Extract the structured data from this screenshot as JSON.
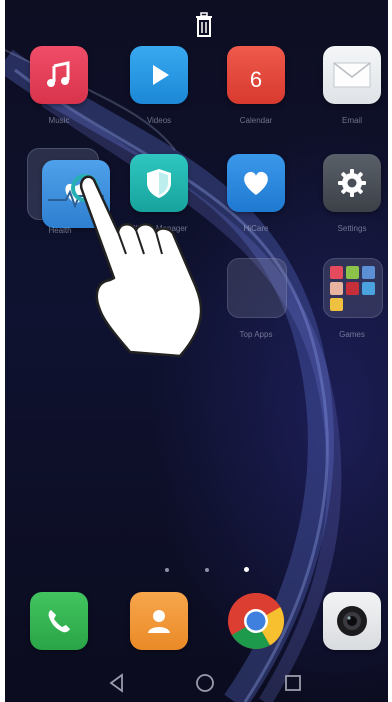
{
  "home": {
    "trash_icon": "trash-icon",
    "apps_row1": [
      {
        "name": "music",
        "label": "Music",
        "color": "#e8405a",
        "icon": "music-note-icon"
      },
      {
        "name": "videos",
        "label": "Videos",
        "color": "#2a9be6",
        "icon": "play-icon"
      },
      {
        "name": "calendar",
        "label": "Calendar",
        "color": "#e34b3f",
        "icon": "calendar-icon",
        "date": "6"
      },
      {
        "name": "email",
        "label": "Email",
        "color": "#e9ecef",
        "icon": "envelope-icon"
      }
    ],
    "apps_row2": [
      {
        "name": "health",
        "label": "Health",
        "color": "#3c8fe0",
        "icon": "heart-pulse-icon"
      },
      {
        "name": "phone-manager",
        "label": "Phone Manager",
        "color": "#22b6b0",
        "icon": "shield-icon"
      },
      {
        "name": "hicare",
        "label": "HiCare",
        "color": "#2d8ae0",
        "icon": "heart-icon"
      },
      {
        "name": "settings",
        "label": "Settings",
        "color": "#4a4f57",
        "icon": "gear-icon"
      }
    ],
    "apps_row3": [
      {
        "name": "top-apps",
        "label": "Top Apps",
        "icon": "empty-folder-icon"
      },
      {
        "name": "games",
        "label": "Games",
        "icon": "folder-icon"
      }
    ],
    "page_indicator": {
      "pages": 3,
      "current": 3
    },
    "dock": [
      {
        "name": "phone",
        "color": "#34b552",
        "icon": "phone-icon"
      },
      {
        "name": "contacts",
        "color": "#f29a3b",
        "icon": "contacts-icon"
      },
      {
        "name": "chrome",
        "icon": "chrome-icon"
      },
      {
        "name": "camera",
        "color": "#eceef0",
        "icon": "camera-icon"
      }
    ],
    "navbar": {
      "back": "back-icon",
      "home": "home-icon",
      "recents": "recents-icon"
    }
  }
}
